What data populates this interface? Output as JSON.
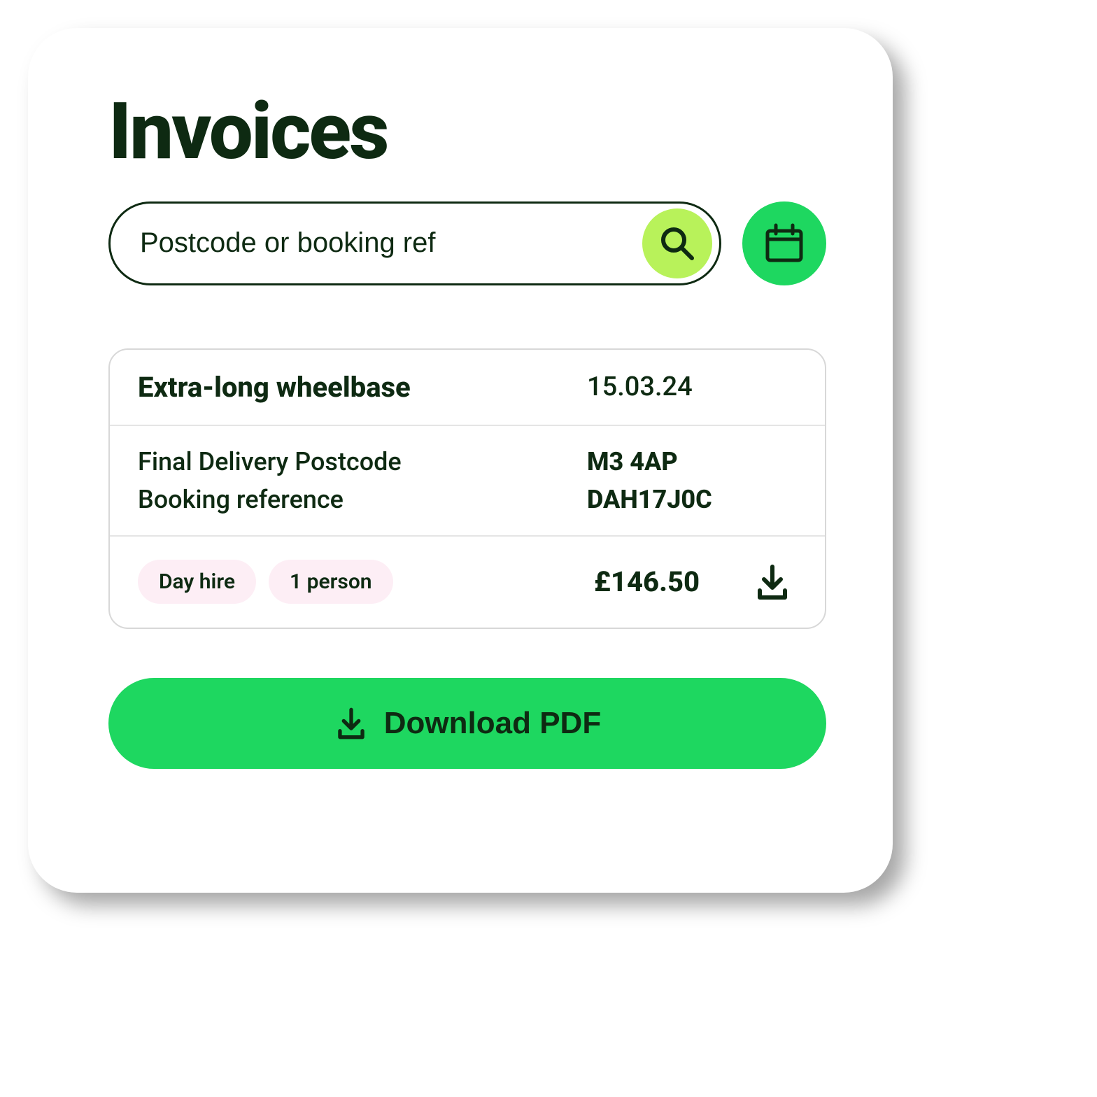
{
  "page": {
    "title": "Invoices"
  },
  "search": {
    "placeholder": "Postcode or booking ref",
    "value": ""
  },
  "invoice": {
    "title": "Extra-long wheelbase",
    "date": "15.03.24",
    "postcode_label": "Final Delivery Postcode",
    "postcode_value": "M3 4AP",
    "booking_label": "Booking reference",
    "booking_value": "DAH17J0C",
    "tags": {
      "hire_type": "Day hire",
      "people": "1 person"
    },
    "price": "£146.50"
  },
  "actions": {
    "download_pdf": "Download PDF"
  },
  "icons": {
    "search": "search-icon",
    "calendar": "calendar-icon",
    "download": "download-icon"
  },
  "colors": {
    "dark_green": "#0e2a12",
    "bright_green": "#1ed760",
    "lime_green": "#b8f25a",
    "pale_pink": "#fdeef5"
  }
}
